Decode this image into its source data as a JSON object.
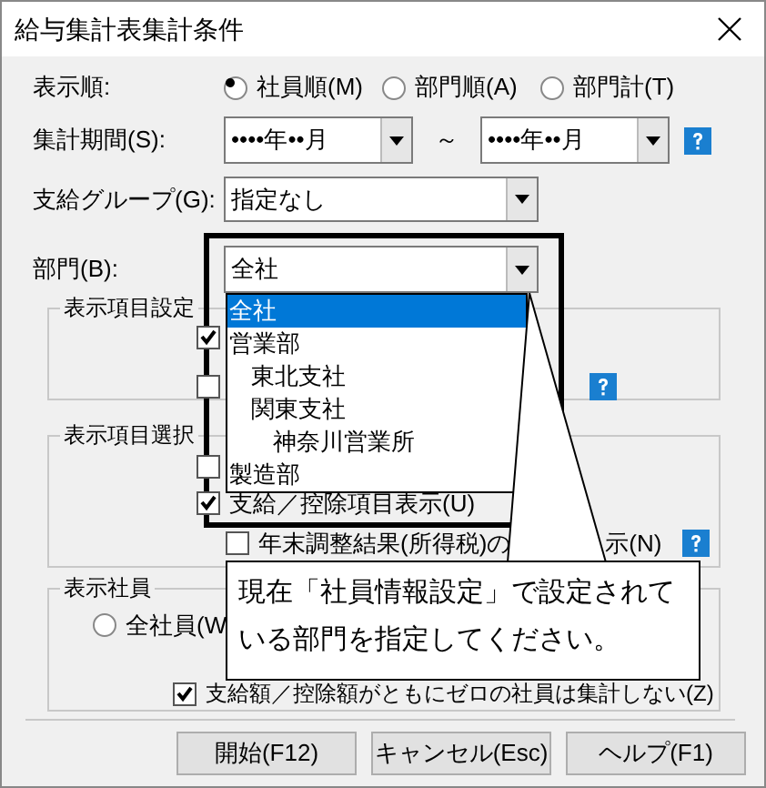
{
  "window": {
    "title": "給与集計表集計条件"
  },
  "display_order": {
    "label": "表示順:",
    "options": [
      {
        "label": "社員順(M)",
        "selected": true
      },
      {
        "label": "部門順(A)",
        "selected": false
      },
      {
        "label": "部門計(T)",
        "selected": false
      }
    ]
  },
  "period": {
    "label": "集計期間(S):",
    "from": "••••年••月",
    "separator": "～",
    "to": "••••年••月"
  },
  "payment_group": {
    "label": "支給グループ(G):",
    "value": "指定なし"
  },
  "department": {
    "label": "部門(B):",
    "value": "全社",
    "dropdown": [
      {
        "label": "全社",
        "selected": true
      },
      {
        "label": "営業部",
        "selected": false,
        "children": [
          {
            "label": "東北支社",
            "selected": false
          },
          {
            "label": "関東支社",
            "selected": false,
            "children": [
              {
                "label": "神奈川営業所",
                "selected": false
              }
            ]
          }
        ]
      },
      {
        "label": "製造部",
        "selected": false
      }
    ]
  },
  "display_settings": {
    "title": "表示項目設定",
    "checkboxes": [
      {
        "checked": true
      },
      {
        "checked": false
      }
    ]
  },
  "display_items": {
    "title": "表示項目選択",
    "checkboxes": [
      {
        "checked": false
      },
      {
        "checked": true,
        "parts": [
          "支給／控除項目表示(U)"
        ]
      },
      {
        "checked": false,
        "parts": [
          "年末調整結果(所得税)の",
          "示(N)"
        ]
      }
    ]
  },
  "display_employees": {
    "title": "表示社員",
    "options": [
      {
        "label": "全社員(W",
        "selected": false
      }
    ],
    "exclude_zero": {
      "label": "支給額／控除額がともにゼロの社員は集計しない(Z)",
      "checked": true
    }
  },
  "callout": {
    "text": "現在「社員情報設定」で設定されている部門を指定してください。"
  },
  "buttons": [
    "開始(F12)",
    "キャンセル(Esc)",
    "ヘルプ(F1)"
  ]
}
